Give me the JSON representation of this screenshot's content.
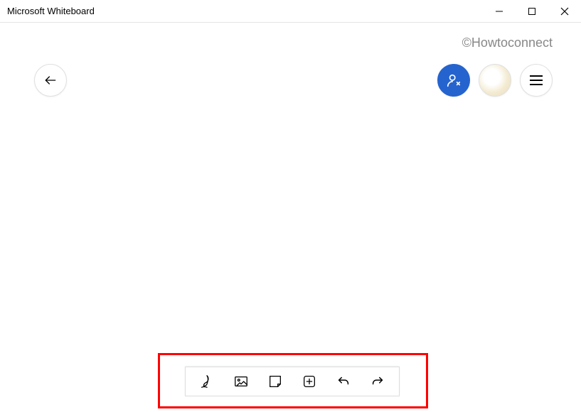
{
  "window": {
    "title": "Microsoft Whiteboard"
  },
  "watermark": "©Howtoconnect",
  "icons": {
    "back": "back-arrow-icon",
    "share": "share-person-icon",
    "avatar": "user-avatar",
    "menu": "hamburger-menu-icon",
    "pen": "ink-pen-icon",
    "image": "image-icon",
    "note": "sticky-note-icon",
    "add": "add-square-icon",
    "undo": "undo-icon",
    "redo": "redo-icon",
    "minimize": "minimize-icon",
    "maximize": "maximize-icon",
    "close": "close-icon"
  },
  "colors": {
    "accent": "#2564cf"
  }
}
